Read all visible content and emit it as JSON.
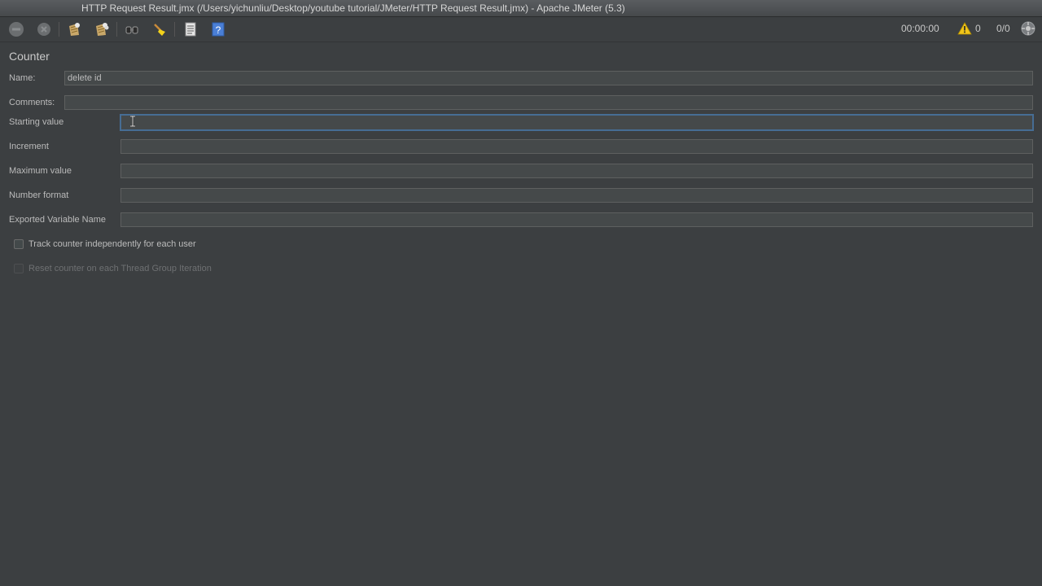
{
  "window": {
    "title": "HTTP Request Result.jmx (/Users/yichunliu/Desktop/youtube tutorial/JMeter/HTTP Request Result.jmx) - Apache JMeter (5.3)"
  },
  "toolbar": {
    "buttons": [
      {
        "name": "stop-icon"
      },
      {
        "name": "shutdown-icon"
      },
      {
        "name": "clear-icon"
      },
      {
        "name": "clear-all-icon"
      },
      {
        "name": "search-icon"
      },
      {
        "name": "reset-search-icon"
      },
      {
        "name": "function-helper-icon"
      },
      {
        "name": "help-icon"
      }
    ],
    "elapsed_time": "00:00:00",
    "warning_count": "0",
    "threads": "0/0"
  },
  "panel": {
    "title": "Counter",
    "name_label": "Name:",
    "name_value": "delete id",
    "comments_label": "Comments:",
    "comments_value": "",
    "starting_value_label": "Starting value",
    "starting_value": "",
    "increment_label": "Increment",
    "increment_value": "",
    "maximum_value_label": "Maximum value",
    "maximum_value": "",
    "number_format_label": "Number format",
    "number_format_value": "",
    "exported_variable_label": "Exported Variable Name",
    "exported_variable_value": "",
    "track_counter_label": "Track counter independently for each user",
    "reset_counter_label": "Reset counter on each Thread Group Iteration"
  },
  "colors": {
    "background": "#3c3f41",
    "field_background": "#45494a",
    "focus_border": "#466d94",
    "warning_yellow": "#f0c419"
  }
}
